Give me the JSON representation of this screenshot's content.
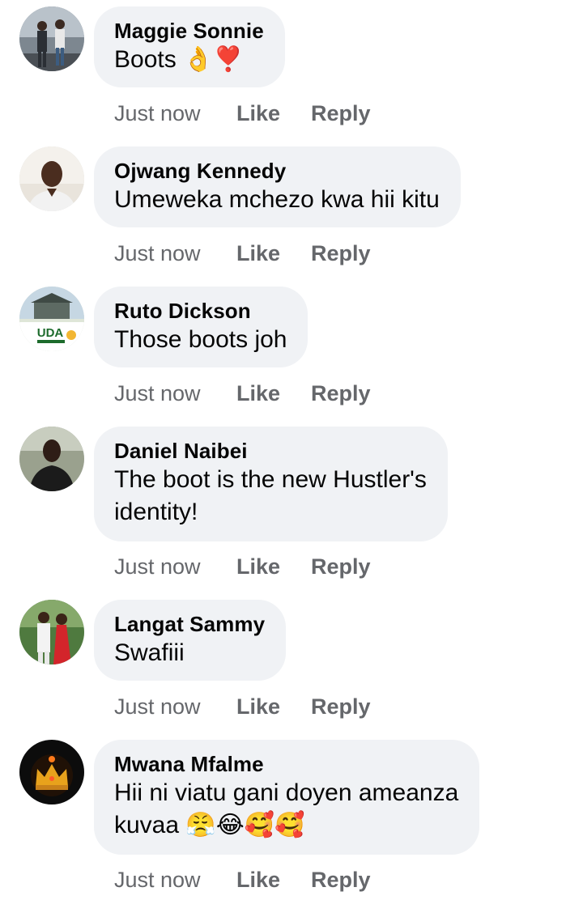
{
  "comments": [
    {
      "author": "Maggie Sonnie",
      "text": "Boots 👌❣️",
      "time": "Just now",
      "like_label": "Like",
      "reply_label": "Reply",
      "avatar_icon": "photo-two-people-avatar-icon"
    },
    {
      "author": "Ojwang Kennedy",
      "text": "Umeweka mchezo kwa hii kitu",
      "time": "Just now",
      "like_label": "Like",
      "reply_label": "Reply",
      "avatar_icon": "photo-person-avatar-icon"
    },
    {
      "author": "Ruto Dickson",
      "text": "Those boots joh",
      "time": "Just now",
      "like_label": "Like",
      "reply_label": "Reply",
      "avatar_icon": "uda-logo-avatar-icon",
      "avatar_logo_text": "UDA"
    },
    {
      "author": "Daniel Naibei",
      "text": "The boot is the new Hustler's\nidentity!",
      "time": "Just now",
      "like_label": "Like",
      "reply_label": "Reply",
      "avatar_icon": "photo-person-avatar-icon"
    },
    {
      "author": "Langat Sammy",
      "text": "Swafiii",
      "time": "Just now",
      "like_label": "Like",
      "reply_label": "Reply",
      "avatar_icon": "photo-couple-avatar-icon"
    },
    {
      "author": "Mwana Mfalme",
      "text": "Hii ni viatu gani doyen ameanza\nkuvaa 😤😂🥰🥰",
      "time": "Just now",
      "like_label": "Like",
      "reply_label": "Reply",
      "avatar_icon": "crown-avatar-icon"
    }
  ],
  "colors": {
    "bubble_bg": "#f0f2f5",
    "author_text": "#050505",
    "action_text": "#65676b"
  }
}
